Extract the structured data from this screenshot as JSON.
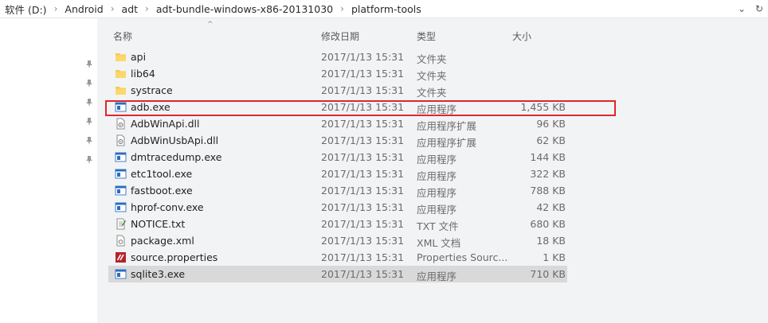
{
  "breadcrumb": [
    "软件 (D:)",
    "Android",
    "adt",
    "adt-bundle-windows-x86-20131030",
    "platform-tools"
  ],
  "columns": {
    "name": "名称",
    "date": "修改日期",
    "type": "类型",
    "size": "大小"
  },
  "files": [
    {
      "name": "api",
      "date": "2017/1/13 15:31",
      "type": "文件夹",
      "size": "",
      "icon": "folder-icon"
    },
    {
      "name": "lib64",
      "date": "2017/1/13 15:31",
      "type": "文件夹",
      "size": "",
      "icon": "folder-icon"
    },
    {
      "name": "systrace",
      "date": "2017/1/13 15:31",
      "type": "文件夹",
      "size": "",
      "icon": "folder-icon"
    },
    {
      "name": "adb.exe",
      "date": "2017/1/13 15:31",
      "type": "应用程序",
      "size": "1,455 KB",
      "icon": "exe-icon"
    },
    {
      "name": "AdbWinApi.dll",
      "date": "2017/1/13 15:31",
      "type": "应用程序扩展",
      "size": "96 KB",
      "icon": "dll-icon"
    },
    {
      "name": "AdbWinUsbApi.dll",
      "date": "2017/1/13 15:31",
      "type": "应用程序扩展",
      "size": "62 KB",
      "icon": "dll-icon"
    },
    {
      "name": "dmtracedump.exe",
      "date": "2017/1/13 15:31",
      "type": "应用程序",
      "size": "144 KB",
      "icon": "exe-icon"
    },
    {
      "name": "etc1tool.exe",
      "date": "2017/1/13 15:31",
      "type": "应用程序",
      "size": "322 KB",
      "icon": "exe-icon"
    },
    {
      "name": "fastboot.exe",
      "date": "2017/1/13 15:31",
      "type": "应用程序",
      "size": "788 KB",
      "icon": "exe-icon"
    },
    {
      "name": "hprof-conv.exe",
      "date": "2017/1/13 15:31",
      "type": "应用程序",
      "size": "42 KB",
      "icon": "exe-icon"
    },
    {
      "name": "NOTICE.txt",
      "date": "2017/1/13 15:31",
      "type": "TXT 文件",
      "size": "680 KB",
      "icon": "txt-icon"
    },
    {
      "name": "package.xml",
      "date": "2017/1/13 15:31",
      "type": "XML 文档",
      "size": "18 KB",
      "icon": "xml-icon"
    },
    {
      "name": "source.properties",
      "date": "2017/1/13 15:31",
      "type": "Properties Sourc...",
      "size": "1 KB",
      "icon": "properties-icon"
    },
    {
      "name": "sqlite3.exe",
      "date": "2017/1/13 15:31",
      "type": "应用程序",
      "size": "710 KB",
      "icon": "exe-icon"
    }
  ],
  "colors": {
    "highlight": "#e0262b",
    "folder": "#f7c94f",
    "exe": "#2b6cc4",
    "selected_row": "#d9d9d9"
  }
}
